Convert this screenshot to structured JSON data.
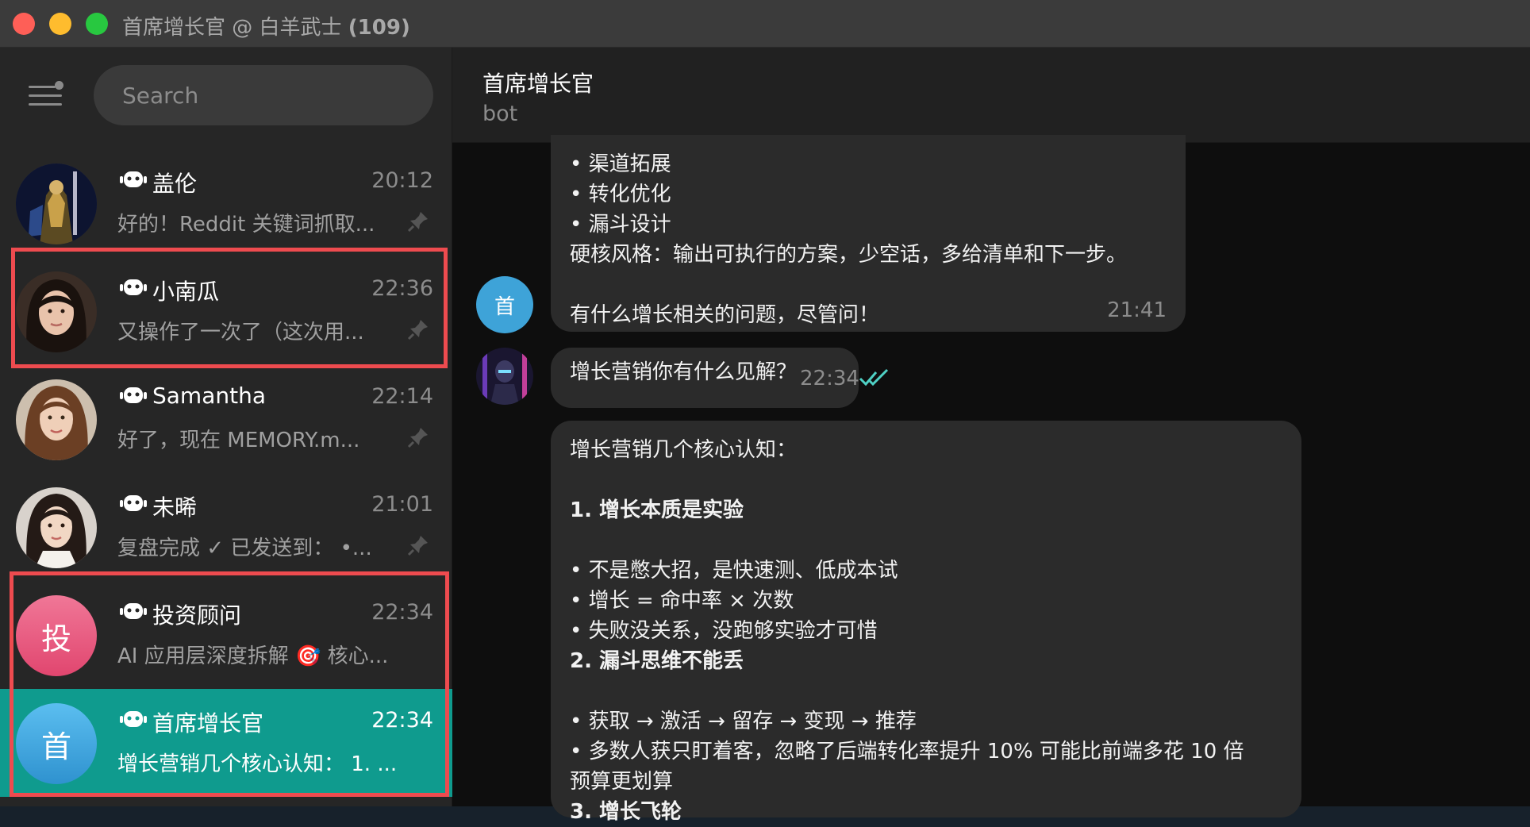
{
  "window": {
    "title_prefix": "首席增长官 @ 白羊武士",
    "title_count": "(109)"
  },
  "sidebar": {
    "search_placeholder": "Search",
    "chats": [
      {
        "name": "盖伦",
        "time": "20:12",
        "preview": "好的！Reddit 关键词抓取...",
        "pinned": true,
        "bot": true
      },
      {
        "name": "小南瓜",
        "time": "22:36",
        "preview": "又操作了一次了（这次用...",
        "pinned": true,
        "bot": true
      },
      {
        "name": "Samantha",
        "time": "22:14",
        "preview": "好了，现在 MEMORY.m...",
        "pinned": true,
        "bot": true
      },
      {
        "name": "未晞",
        "time": "21:01",
        "preview": "复盘完成 ✓ 已发送到： •...",
        "pinned": true,
        "bot": true
      },
      {
        "name": "投资顾问",
        "time": "22:34",
        "preview": "AI 应用层深度拆解 🎯 核心...",
        "avatar_letter": "投",
        "bot": true
      },
      {
        "name": "首席增长官",
        "time": "22:34",
        "preview": "增长营销几个核心认知： 1. ...",
        "avatar_letter": "首",
        "bot": true,
        "active": true
      }
    ]
  },
  "chat": {
    "name": "首席增长官",
    "status": "bot",
    "messages": [
      {
        "from": "bot",
        "avatar_letter": "首",
        "lines": [
          "• 渠道拓展",
          "• 转化优化",
          "• 漏斗设计",
          "硬核风格：输出可执行的方案，少空话，多给清单和下一步。",
          "",
          "有什么增长相关的问题，尽管问！"
        ],
        "time": "21:41"
      },
      {
        "from": "me",
        "lines": [
          "增长营销你有什么见解？"
        ],
        "time": "22:34",
        "read": true
      },
      {
        "from": "bot",
        "lines": [
          "增长营销几个核心认知：",
          "",
          "1. 增长本质是实验",
          "",
          "• 不是憋大招，是快速测、低成本试",
          "• 增长 = 命中率 × 次数",
          "• 失败没关系，没跑够实验才可惜",
          "2. 漏斗思维不能丢",
          "",
          "• 获取 → 激活 → 留存 → 变现 → 推荐",
          "• 多数人获只盯着客，忽略了后端转化率提升 10% 可能比前端多花 10 倍",
          "预算更划算",
          "3. 增长飞轮"
        ]
      }
    ]
  },
  "colors": {
    "active_chat": "#0f9b8e",
    "highlight_box": "#ee4b4f",
    "read_check": "#4fd1c5",
    "avatar_invest": "#e85a7f",
    "avatar_growth": "#3ea3d8"
  }
}
